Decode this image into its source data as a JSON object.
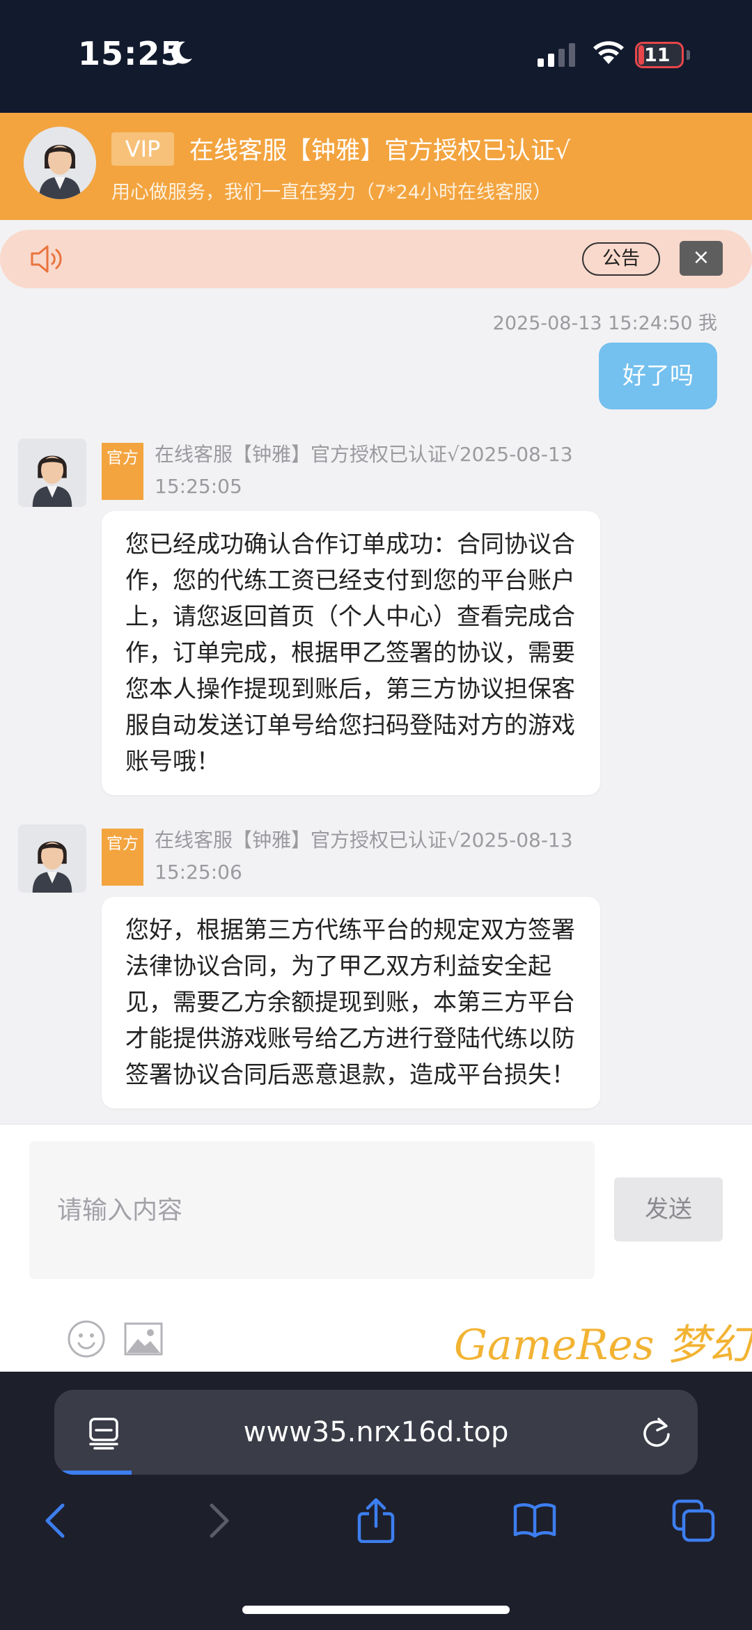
{
  "status_bar": {
    "time": "15:25",
    "battery": "11"
  },
  "header": {
    "vip": "VIP",
    "title": "在线客服【钟雅】官方授权已认证√",
    "subtitle": "用心做服务，我们一直在努力（7*24小时在线客服）",
    "avatar": "agent-avatar"
  },
  "notice": {
    "tag": "公告",
    "close": "×",
    "icon": "speaker-icon"
  },
  "chat": {
    "my_message": {
      "time": "2025-08-13 15:24:50 我",
      "text": "好了吗"
    },
    "messages": [
      {
        "tag": "官方",
        "meta": "在线客服【钟雅】官方授权已认证√2025-08-13 15:25:05",
        "text": "您已经成功确认合作订单成功：合同协议合作，您的代练工资已经支付到您的平台账户上，请您返回首页（个人中心）查看完成合作，订单完成，根据甲乙签署的协议，需要您本人操作提现到账后，第三方协议担保客服自动发送订单号给您扫码登陆对方的游戏账号哦！"
      },
      {
        "tag": "官方",
        "meta": "在线客服【钟雅】官方授权已认证√2025-08-13 15:25:06",
        "text": "您好，根据第三方代练平台的规定双方签署法律协议合同，为了甲乙双方利益安全起见，需要乙方余额提现到账，本第三方平台才能提供游戏账号给乙方进行登陆代练以防签署协议合同后恶意退款，造成平台损失！"
      }
    ]
  },
  "input": {
    "placeholder": "请输入内容",
    "send": "发送",
    "watermark": "GameRes 梦幻"
  },
  "browser": {
    "url": "www35.nrx16d.top",
    "load_progress": 0.12
  },
  "colors": {
    "header_orange": "#f3a43f",
    "my_bubble": "#74c0ef",
    "notice_bg": "#f9d9cc",
    "browser_bg": "#1d1f2b"
  }
}
